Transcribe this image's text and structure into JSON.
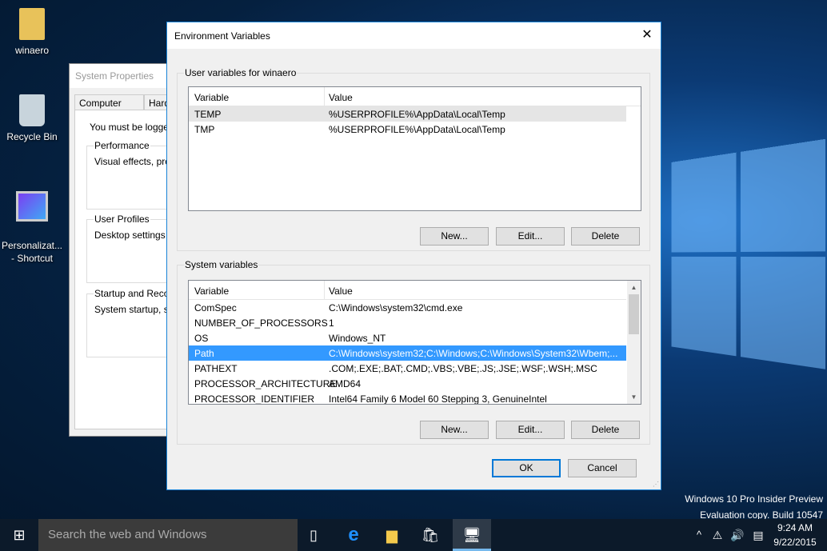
{
  "desktop": {
    "icons": [
      "winaero",
      "Recycle Bin",
      "Personalizat...\n- Shortcut"
    ],
    "watermark": [
      "Windows 10 Pro Insider Preview",
      "Evaluation copy. Build 10547"
    ]
  },
  "system_properties": {
    "title": "System Properties",
    "tabs": [
      "Computer Name",
      "Hard"
    ],
    "notice": "You must be logged",
    "groups": [
      {
        "label": "Performance",
        "text": "Visual effects, proce"
      },
      {
        "label": "User Profiles",
        "text": "Desktop settings re"
      },
      {
        "label": "Startup and Recove",
        "text": "System startup, syst"
      }
    ]
  },
  "dialog": {
    "title": "Environment Variables",
    "close": "✕",
    "user": {
      "label": "User variables for winaero",
      "headers": [
        "Variable",
        "Value"
      ],
      "rows": [
        [
          "TEMP",
          "%USERPROFILE%\\AppData\\Local\\Temp"
        ],
        [
          "TMP",
          "%USERPROFILE%\\AppData\\Local\\Temp"
        ]
      ],
      "buttons": [
        "New...",
        "Edit...",
        "Delete"
      ]
    },
    "system": {
      "label": "System variables",
      "headers": [
        "Variable",
        "Value"
      ],
      "rows": [
        [
          "ComSpec",
          "C:\\Windows\\system32\\cmd.exe"
        ],
        [
          "NUMBER_OF_PROCESSORS",
          "1"
        ],
        [
          "OS",
          "Windows_NT"
        ],
        [
          "Path",
          "C:\\Windows\\system32;C:\\Windows;C:\\Windows\\System32\\Wbem;..."
        ],
        [
          "PATHEXT",
          ".COM;.EXE;.BAT;.CMD;.VBS;.VBE;.JS;.JSE;.WSF;.WSH;.MSC"
        ],
        [
          "PROCESSOR_ARCHITECTURE",
          "AMD64"
        ],
        [
          "PROCESSOR_IDENTIFIER",
          "Intel64 Family 6 Model 60 Stepping 3, GenuineIntel"
        ]
      ],
      "selected": 3,
      "buttons": [
        "New...",
        "Edit...",
        "Delete"
      ]
    },
    "ok": "OK",
    "cancel": "Cancel"
  },
  "taskbar": {
    "search_placeholder": "Search the web and Windows",
    "time": "9:24 AM",
    "date": "9/22/2015"
  }
}
